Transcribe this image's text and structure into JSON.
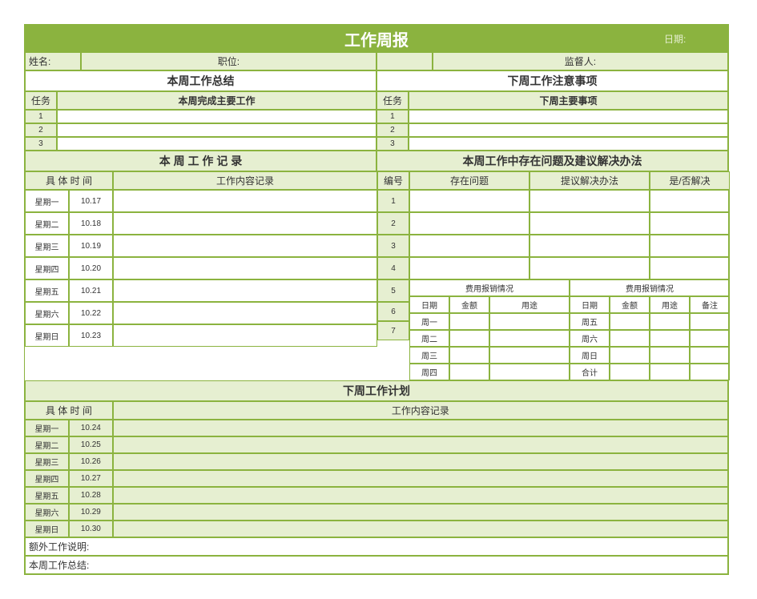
{
  "header": {
    "title": "工作周报",
    "date_label": "日期:"
  },
  "info_row": {
    "name_label": "姓名:",
    "position_label": "职位:",
    "supervisor_label": "监督人:"
  },
  "summary": {
    "left_title": "本周工作总结",
    "right_title": "下周工作注意事项",
    "task_label": "任务",
    "left_sub": "本周完成主要工作",
    "right_sub": "下周主要事项",
    "nums": [
      "1",
      "2",
      "3"
    ]
  },
  "record": {
    "left_title": "本 周 工 作 记 录",
    "right_title": "本周工作中存在问题及建议解决办法",
    "time_label": "具 体 时 间",
    "content_label": "工作内容记录",
    "idx_label": "编号",
    "exists_label": "存在问题",
    "suggest_label": "提议解决办法",
    "resolved_label": "是/否解决",
    "days": [
      {
        "day": "星期一",
        "date": "10.17"
      },
      {
        "day": "星期二",
        "date": "10.18"
      },
      {
        "day": "星期三",
        "date": "10.19"
      },
      {
        "day": "星期四",
        "date": "10.20"
      },
      {
        "day": "星期五",
        "date": "10.21"
      },
      {
        "day": "星期六",
        "date": "10.22"
      },
      {
        "day": "星期日",
        "date": "10.23"
      }
    ],
    "issue_nums": [
      "1",
      "2",
      "3",
      "4"
    ],
    "expense": {
      "nums": [
        "5",
        "6",
        "7"
      ],
      "title": "费用报销情况",
      "cols_left": {
        "date": "日期",
        "amount": "金额",
        "purpose": "用途"
      },
      "cols_right": {
        "date": "日期",
        "amount": "金额",
        "purpose": "用途",
        "note": "备注"
      },
      "rows_left": [
        "周一",
        "周二",
        "周三",
        "周四"
      ],
      "rows_right": [
        "周五",
        "周六",
        "周日",
        "合计"
      ]
    }
  },
  "plan": {
    "title": "下周工作计划",
    "time_label": "具 体 时 间",
    "content_label": "工作内容记录",
    "days": [
      {
        "day": "星期一",
        "date": "10.24"
      },
      {
        "day": "星期二",
        "date": "10.25"
      },
      {
        "day": "星期三",
        "date": "10.26"
      },
      {
        "day": "星期四",
        "date": "10.27"
      },
      {
        "day": "星期五",
        "date": "10.28"
      },
      {
        "day": "星期六",
        "date": "10.29"
      },
      {
        "day": "星期日",
        "date": "10.30"
      }
    ]
  },
  "footer": {
    "extra": "额外工作说明:",
    "summary": "本周工作总结:"
  }
}
